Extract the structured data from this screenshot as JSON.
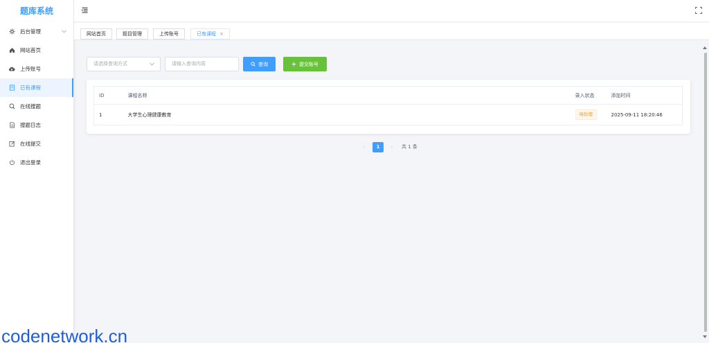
{
  "app": {
    "logo_text": "题库系统"
  },
  "sidebar": {
    "items": [
      {
        "label": "后台管理",
        "icon": "gear-icon",
        "active": false,
        "has_children": true
      },
      {
        "label": "网站首页",
        "icon": "home-icon",
        "active": false
      },
      {
        "label": "上传账号",
        "icon": "cloud-upload-icon",
        "active": false
      },
      {
        "label": "已有课程",
        "icon": "document-icon",
        "active": true
      },
      {
        "label": "在线搜题",
        "icon": "search-icon",
        "active": false
      },
      {
        "label": "搜题日志",
        "icon": "log-icon",
        "active": false
      },
      {
        "label": "在线提交",
        "icon": "edit-icon",
        "active": false
      },
      {
        "label": "退出登录",
        "icon": "power-icon",
        "active": false
      }
    ]
  },
  "tabs": [
    {
      "label": "网站首页",
      "active": false
    },
    {
      "label": "题目管理",
      "active": false
    },
    {
      "label": "上传账号",
      "active": false
    },
    {
      "label": "已有课程",
      "active": true,
      "close": "×"
    }
  ],
  "search": {
    "select_placeholder": "请选择查询方式",
    "input_placeholder": "请输入查询内容",
    "search_button": "查询",
    "submit_button": "提交账号"
  },
  "table": {
    "headers": [
      "ID",
      "课程名称",
      "录入状态",
      "添加时间"
    ],
    "rows": [
      {
        "id": "1",
        "name": "大学生心理健康教育",
        "status": "待处理",
        "time": "2025-09-11 18:20:46"
      }
    ]
  },
  "pagination": {
    "prev": "‹",
    "current": "1",
    "next": "›",
    "total": "共 1 条"
  },
  "watermark": "codenetwork.cn",
  "colors": {
    "primary": "#409eff",
    "success": "#67c23a",
    "warning": "#e6a23c",
    "watermark": "#1f5fd6"
  }
}
